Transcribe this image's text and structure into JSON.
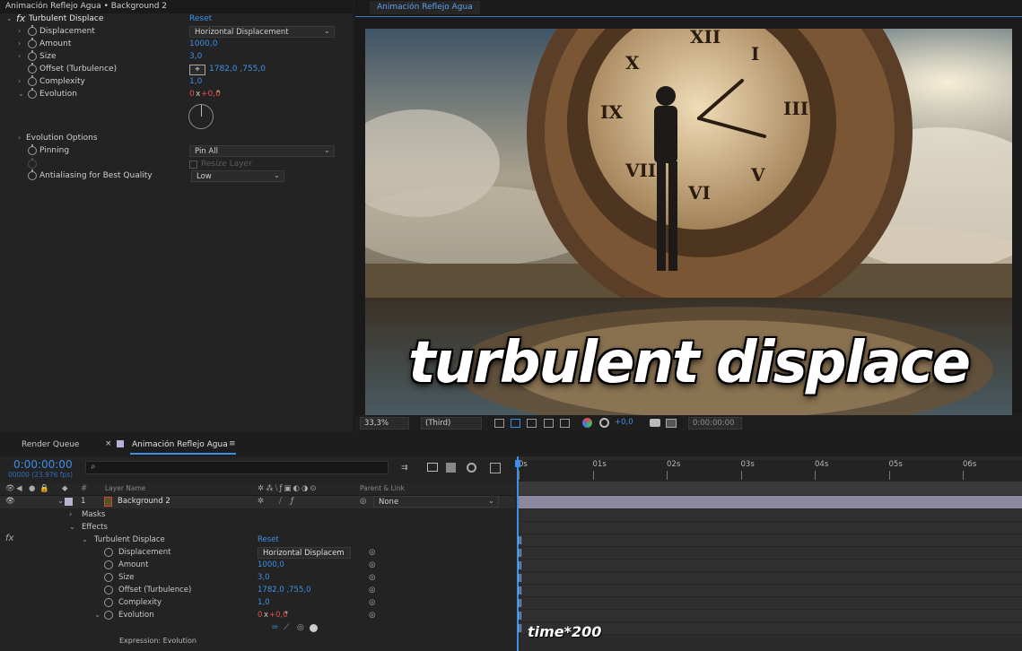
{
  "effect_controls": {
    "header": "Animación Reflejo Agua • Background 2",
    "effect_name": "Turbulent Displace",
    "reset_label": "Reset",
    "fx_label": "fx",
    "displacement": {
      "label": "Displacement",
      "value": "Horizontal Displacement"
    },
    "amount": {
      "label": "Amount",
      "value": "1000,0"
    },
    "size": {
      "label": "Size",
      "value": "3,0"
    },
    "offset": {
      "label": "Offset (Turbulence)",
      "value": "1782,0 ,755,0"
    },
    "complexity": {
      "label": "Complexity",
      "value": "1,0"
    },
    "evolution": {
      "label": "Evolution",
      "value_rev": "0",
      "value_x": "x",
      "value_deg": "+0,0",
      "value_unit": "°"
    },
    "evolution_options": {
      "label": "Evolution Options"
    },
    "pinning": {
      "label": "Pinning",
      "value": "Pin All"
    },
    "resize_layer": {
      "label": "Resize Layer"
    },
    "antialiasing": {
      "label": "Antialiasing for Best Quality",
      "value": "Low"
    }
  },
  "viewer": {
    "tab": "Animación Reflejo Agua",
    "caption": "turbulent displace",
    "zoom": "33,3%",
    "resolution": "(Third)",
    "exposure": "+0,0",
    "timecode": "0:00:00:00"
  },
  "timeline": {
    "tabs": {
      "render_queue": "Render Queue",
      "comp": "Animación Reflejo Agua",
      "close": "×",
      "menu": "≡"
    },
    "current_time": "0:00:00:00",
    "fps": "00000 (23.976 fps)",
    "search_placeholder": "",
    "headers": {
      "hash": "#",
      "layer_name": "Layer Name",
      "parent": "Parent & Link"
    },
    "ticks": [
      "0s",
      "01s",
      "02s",
      "03s",
      "04s",
      "05s",
      "06s"
    ],
    "layer": {
      "number": "1",
      "name": "Background 2",
      "parent": "None"
    },
    "masks": "Masks",
    "effects": "Effects",
    "effect_name": "Turbulent Displace",
    "reset_label": "Reset",
    "fx_label": "fx",
    "props": [
      {
        "label": "Displacement",
        "value": "Horizontal Displacem"
      },
      {
        "label": "Amount",
        "value": "1000,0"
      },
      {
        "label": "Size",
        "value": "3,0"
      },
      {
        "label": "Offset (Turbulence)",
        "value": "1782,0 ,755,0"
      },
      {
        "label": "Complexity",
        "value": "1,0"
      },
      {
        "label": "Evolution",
        "value_rev": "0",
        "value_x": "x",
        "value_deg": "+0,0",
        "value_unit": "°"
      }
    ],
    "expression_label": "Expression: Evolution",
    "expression_text": "time*200"
  },
  "colors": {
    "accent": "#3d8fe6",
    "keyframe_red": "#e05050",
    "layer_color": "#b9b2d3"
  }
}
